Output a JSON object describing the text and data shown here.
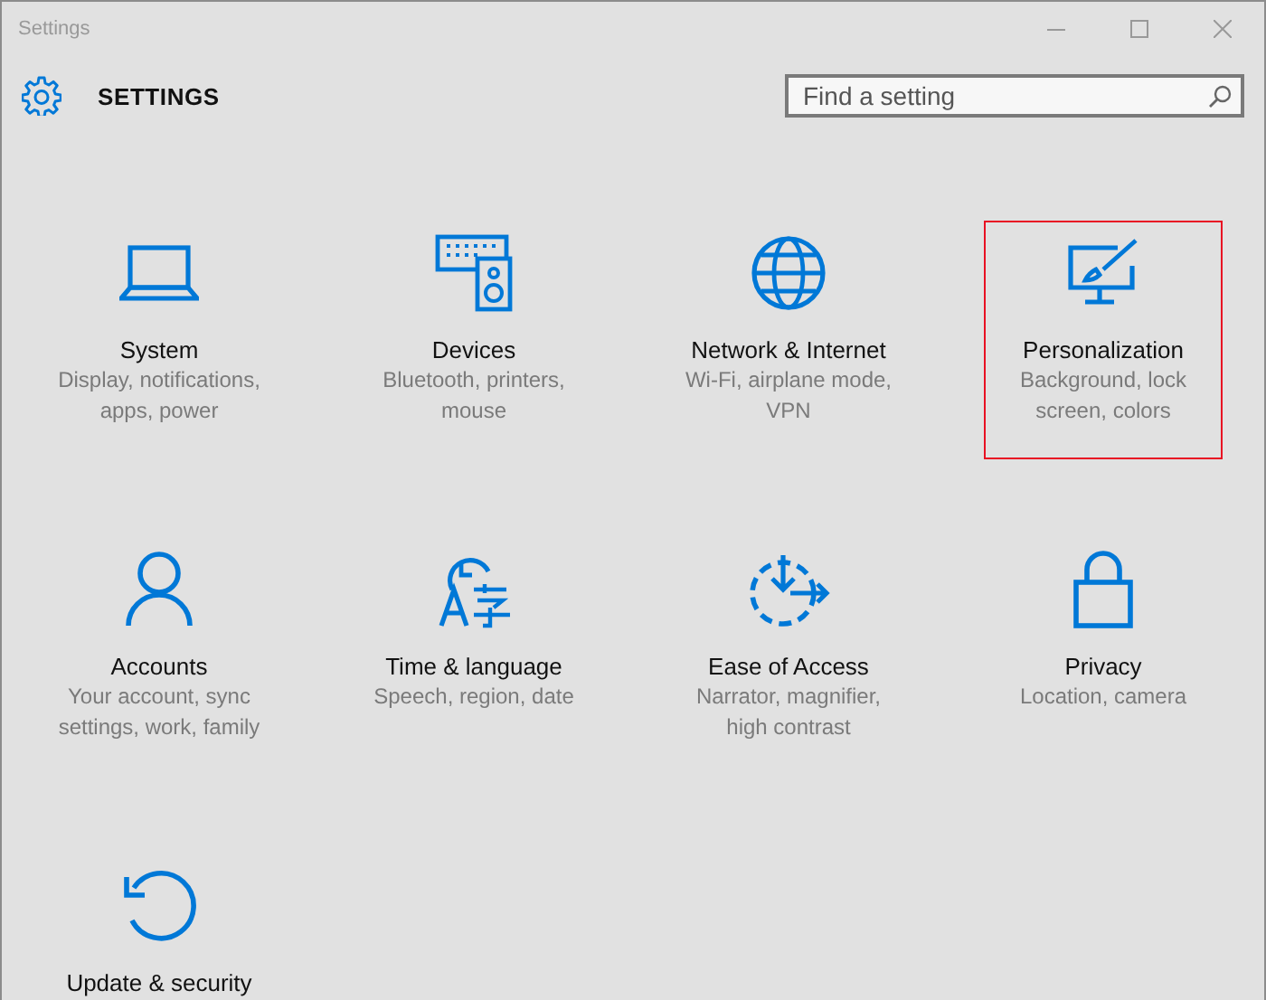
{
  "window": {
    "title": "Settings"
  },
  "header": {
    "title": "SETTINGS"
  },
  "search": {
    "placeholder": "Find a setting"
  },
  "categories": [
    {
      "kind": "laptop",
      "title": "System",
      "description": "Display, notifications, apps, power",
      "highlighted": false
    },
    {
      "kind": "devices",
      "title": "Devices",
      "description": "Bluetooth, printers, mouse",
      "highlighted": false
    },
    {
      "kind": "globe",
      "title": "Network & Internet",
      "description": "Wi-Fi, airplane mode, VPN",
      "highlighted": false
    },
    {
      "kind": "paint",
      "title": "Personalization",
      "description": "Background, lock screen, colors",
      "highlighted": true
    },
    {
      "kind": "person",
      "title": "Accounts",
      "description": "Your account, sync settings, work, family",
      "highlighted": false
    },
    {
      "kind": "language",
      "title": "Time & language",
      "description": "Speech, region, date",
      "highlighted": false
    },
    {
      "kind": "access",
      "title": "Ease of Access",
      "description": "Narrator, magnifier, high contrast",
      "highlighted": false
    },
    {
      "kind": "lock",
      "title": "Privacy",
      "description": "Location, camera",
      "highlighted": false
    },
    {
      "kind": "update",
      "title": "Update & security",
      "highlighted": false
    }
  ]
}
